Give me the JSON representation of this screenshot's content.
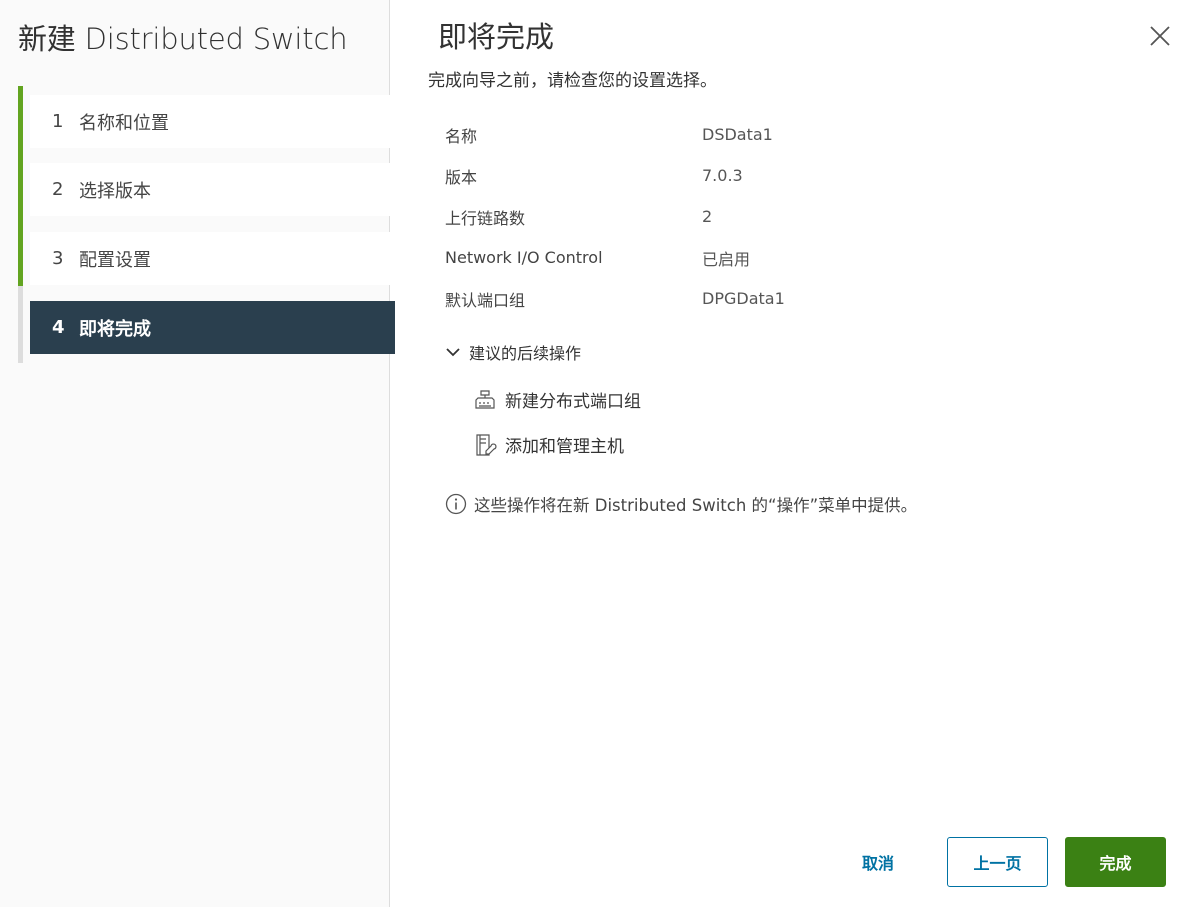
{
  "sidebar": {
    "title": "新建 Distributed Switch",
    "steps": [
      {
        "num": "1",
        "label": "名称和位置"
      },
      {
        "num": "2",
        "label": "选择版本"
      },
      {
        "num": "3",
        "label": "配置设置"
      },
      {
        "num": "4",
        "label": "即将完成"
      }
    ]
  },
  "main": {
    "title": "即将完成",
    "description": "完成向导之前，请检查您的设置选择。",
    "summary": [
      {
        "key": "名称",
        "value": "DSData1"
      },
      {
        "key": "版本",
        "value": "7.0.3"
      },
      {
        "key": "上行链路数",
        "value": "2"
      },
      {
        "key": "Network I/O Control",
        "value": "已启用"
      },
      {
        "key": "默认端口组",
        "value": "DPGData1"
      }
    ],
    "next_steps": {
      "label": "建议的后续操作",
      "actions": [
        {
          "label": "新建分布式端口组",
          "icon": "port-group-icon"
        },
        {
          "label": "添加和管理主机",
          "icon": "manage-hosts-icon"
        }
      ]
    },
    "info_note": "这些操作将在新 Distributed Switch 的“操作”菜单中提供。"
  },
  "footer": {
    "cancel_label": "取消",
    "back_label": "上一页",
    "finish_label": "完成"
  },
  "colors": {
    "active_step": "#2a3f4e",
    "progress": "#62a420",
    "primary": "#0072a3",
    "finish": "#3b8114"
  }
}
